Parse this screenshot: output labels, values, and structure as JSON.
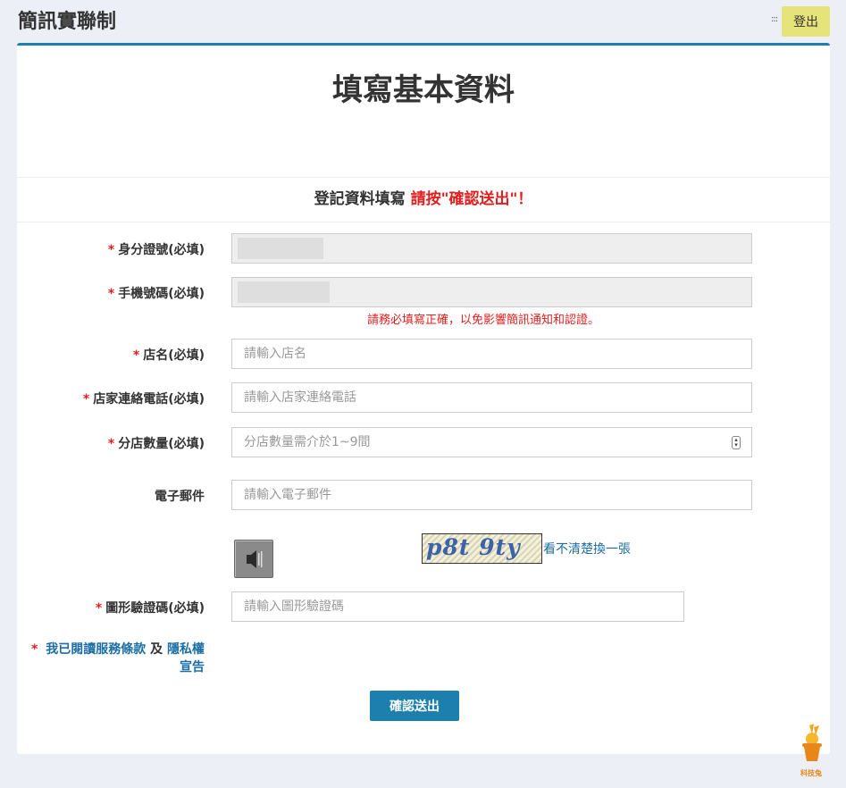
{
  "header": {
    "app_title": "簡訊實聯制",
    "menu_glyph": ":::",
    "logout_label": "登出"
  },
  "form": {
    "page_title": "填寫基本資料",
    "subheader_prefix": "登記資料填寫",
    "subheader_emphasis": "請按\"確認送出\"！",
    "required_mark": "*",
    "fields": {
      "id_number": {
        "label": "身分證號(必填)"
      },
      "mobile": {
        "label": "手機號碼(必填)",
        "note": "請務必填寫正確，以免影響簡訊通知和認證。"
      },
      "store_name": {
        "label": "店名(必填)",
        "placeholder": "請輸入店名"
      },
      "store_phone": {
        "label": "店家連絡電話(必填)",
        "placeholder": "請輸入店家連絡電話"
      },
      "branch_count": {
        "label": "分店數量(必填)",
        "placeholder": "分店數量需介於1~9間"
      },
      "email": {
        "label": "電子郵件",
        "placeholder": "請輸入電子郵件"
      },
      "captcha": {
        "image_text": "p8t 9ty",
        "refresh_link": "看不清楚換一張",
        "label": "圖形驗證碼(必填)",
        "placeholder": "請輸入圖形驗證碼"
      }
    },
    "terms": {
      "prefix": "我已閱讀",
      "service_terms": "服務條款",
      "conjunction": "及",
      "privacy_line1": "隱私權",
      "privacy_line2": "宣告"
    },
    "submit_label": "確認送出"
  },
  "mascot": {
    "caption": "科技兔",
    "icon": "rabbit-hat-icon",
    "color": "#e8861a"
  },
  "colors": {
    "accent": "#1c7fae",
    "required": "#e31e1e",
    "logout_bg": "#e6e37a"
  }
}
